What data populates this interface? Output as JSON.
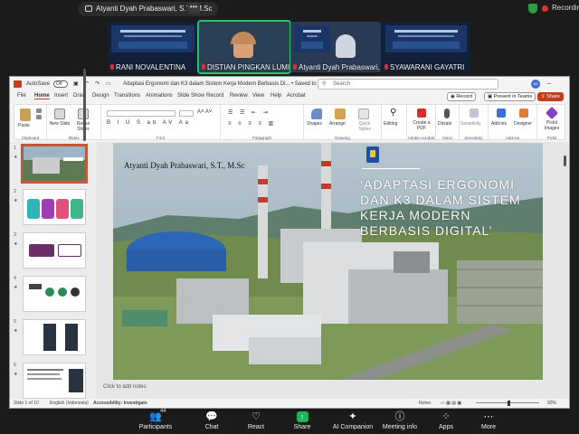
{
  "zoom": {
    "share_label": "Atyanti Dyah Prabaswari, S.T., M.Sc",
    "more_dots": "•••",
    "recording_label": "Recording",
    "participants": [
      {
        "name": "RANI NOVALENTINA"
      },
      {
        "name": "DISTIAN PINGKAN LUMI"
      },
      {
        "name": "Atyanti Dyah Prabaswari, S..."
      },
      {
        "name": "SYAWARANI GAYATRI"
      }
    ],
    "toolbar": {
      "participants_label": "Participants",
      "participants_count": "44",
      "chat_label": "Chat",
      "react_label": "React",
      "share_label": "Share",
      "companion_label": "AI Companion",
      "meeting_info_label": "Meeting info",
      "apps_label": "Apps",
      "more_label": "More"
    }
  },
  "ppt": {
    "autosave_label": "AutoSave",
    "autosave_state": "Off",
    "doc_title": "Adaptasi Ergonomi dan K3 dalam Sistem Kerja Modern Berbasis Di...",
    "saved_label": "Saved to this PC",
    "search_placeholder": "Search",
    "avatar_initials": "AD",
    "menu": [
      "File",
      "Home",
      "Insert",
      "Draw",
      "Design",
      "Transitions",
      "Animations",
      "Slide Show",
      "Record",
      "Review",
      "View",
      "Help",
      "Acrobat"
    ],
    "record_btn": "Record",
    "present_btn": "Present in Teams",
    "share_btn": "Share",
    "ribbon_groups": {
      "clipboard": "Clipboard",
      "slides": "Slides",
      "font": "Font",
      "paragraph": "Paragraph",
      "drawing": "Drawing",
      "adobe": "Adobe Acrobat",
      "voice": "Voice",
      "sensitivity": "Sensitivity",
      "addins": "Add-ins",
      "pickit": "Pickit"
    },
    "ribbon_buttons": {
      "paste": "Paste",
      "new_slide": "New Slide",
      "reuse_slides": "Reuse Slides",
      "shapes": "Shapes",
      "arrange": "Arrange",
      "quick_styles": "Quick Styles",
      "editing": "Editing",
      "create_pdf": "Create a PDF",
      "dictate": "Dictate",
      "sensitivity": "Sensitivity",
      "addins": "Add-ins",
      "designer": "Designer",
      "pickit_images": "Pickit Images"
    },
    "thumb_numbers": [
      "1",
      "2",
      "3",
      "4",
      "5",
      "6"
    ],
    "slide": {
      "presenter": "Atyanti Dyah Prabaswari, S.T., M.Sc",
      "title": "‘ADAPTASI ERGONOMI DAN K3 DALAM SISTEM KERJA MODERN BERBASIS DIGITAL’"
    },
    "notes_placeholder": "Click to add notes",
    "status": {
      "slide_of": "Slide 1 of 10",
      "language": "English (Indonesia)",
      "accessibility": "Accessibility: Investigate",
      "notes": "Notes",
      "zoom": "90%"
    }
  }
}
